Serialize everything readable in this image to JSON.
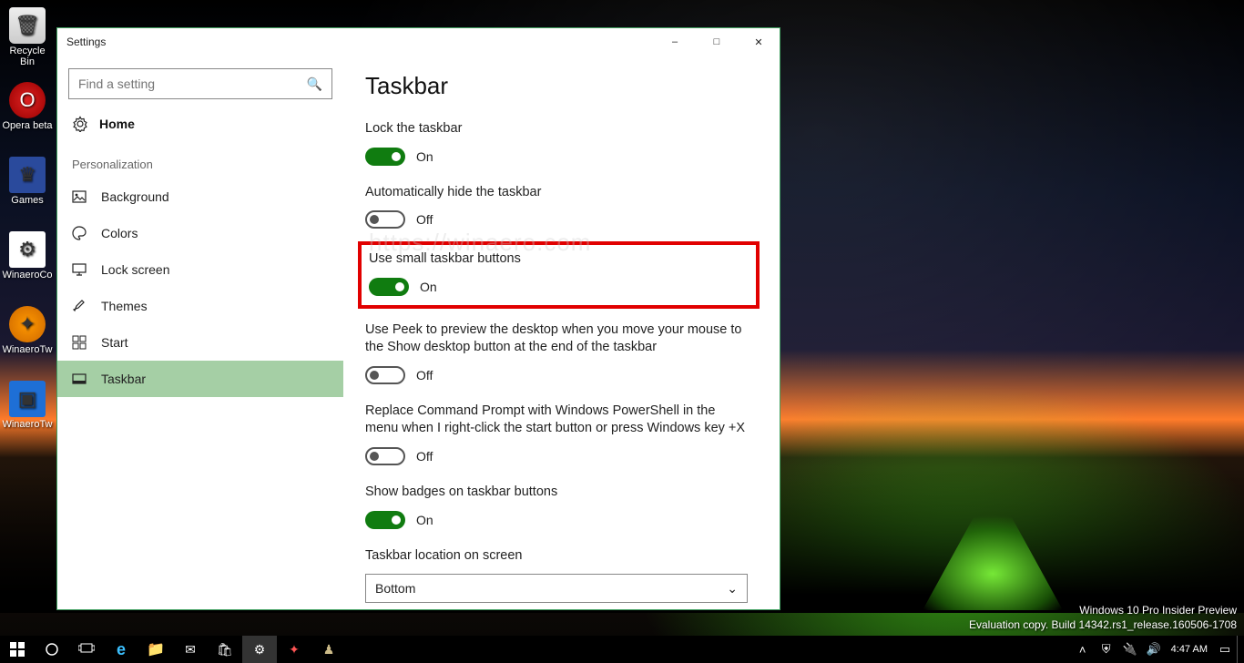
{
  "desktop": {
    "icons": [
      {
        "label": "Recycle Bin"
      },
      {
        "label": "Opera beta"
      },
      {
        "label": "Games"
      },
      {
        "label": "WinaeroCo"
      },
      {
        "label": "WinaeroTw"
      },
      {
        "label": "WinaeroTw"
      }
    ]
  },
  "watermark": {
    "line1": "Windows 10 Pro Insider Preview",
    "line2": "Evaluation copy. Build 14342.rs1_release.160506-1708"
  },
  "taskbar": {
    "clock": "4:47 AM"
  },
  "settings": {
    "title": "Settings",
    "search_placeholder": "Find a setting",
    "home_label": "Home",
    "section_label": "Personalization",
    "nav": [
      {
        "label": "Background"
      },
      {
        "label": "Colors"
      },
      {
        "label": "Lock screen"
      },
      {
        "label": "Themes"
      },
      {
        "label": "Start"
      },
      {
        "label": "Taskbar"
      }
    ],
    "page_heading": "Taskbar",
    "items": {
      "lock": {
        "label": "Lock the taskbar",
        "state": "On",
        "on": true
      },
      "autohide": {
        "label": "Automatically hide the taskbar",
        "state": "Off",
        "on": false
      },
      "small": {
        "label": "Use small taskbar buttons",
        "state": "On",
        "on": true
      },
      "peek": {
        "label": "Use Peek to preview the desktop when you move your mouse to the Show desktop button at the end of the taskbar",
        "state": "Off",
        "on": false
      },
      "powershell": {
        "label": "Replace Command Prompt with Windows PowerShell in the menu when I right-click the start button or press Windows key +X",
        "state": "Off",
        "on": false
      },
      "badges": {
        "label": "Show badges on taskbar buttons",
        "state": "On",
        "on": true
      },
      "location": {
        "label": "Taskbar location on screen",
        "value": "Bottom"
      }
    },
    "content_watermark": "https://winaero.com"
  }
}
